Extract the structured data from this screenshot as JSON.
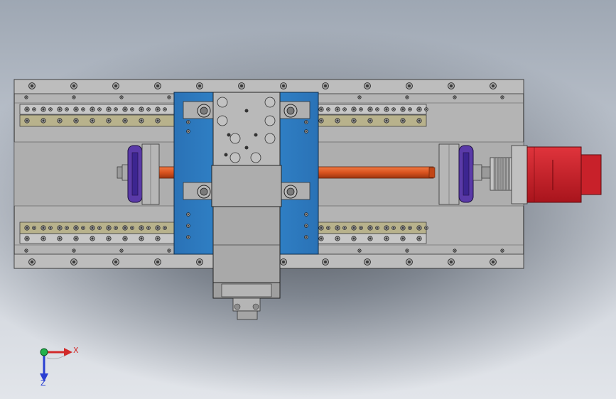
{
  "scene": {
    "view": "top",
    "colors": {
      "background_top": "#9ea7b3",
      "background_bottom": "#e2e5ea",
      "base_plate": "#b3b3b3",
      "rail": "#b8b28c",
      "carriage": "#2b7bc1",
      "screw": "#d9531f",
      "bearing_disc": "#5a3aa8",
      "motor": "#d01f2a",
      "edge": "#222222"
    },
    "parts": [
      {
        "name": "base-plate",
        "icon": "plate-icon"
      },
      {
        "name": "linear-rail-top",
        "icon": "rail-icon"
      },
      {
        "name": "linear-rail-bottom",
        "icon": "rail-icon"
      },
      {
        "name": "carriage-plate",
        "icon": "carriage-icon"
      },
      {
        "name": "ball-screw",
        "icon": "screw-icon"
      },
      {
        "name": "bearing-left",
        "icon": "bearing-icon"
      },
      {
        "name": "bearing-right",
        "icon": "bearing-icon"
      },
      {
        "name": "coupling",
        "icon": "coupling-icon"
      },
      {
        "name": "servo-motor",
        "icon": "motor-icon"
      }
    ]
  },
  "triad": {
    "x_label": "X",
    "z_label": "Z",
    "x_color": "#d22a2a",
    "y_color": "#22b24c",
    "z_color": "#2a3fd2"
  }
}
